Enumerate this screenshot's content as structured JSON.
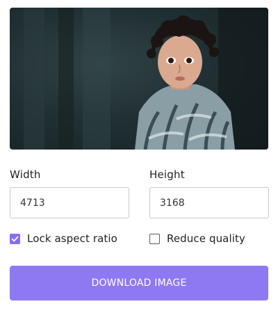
{
  "preview": {
    "image_subject": "child-portrait-photo"
  },
  "dimensions": {
    "width_label": "Width",
    "width_value": "4713",
    "height_label": "Height",
    "height_value": "3168"
  },
  "options": {
    "lock_aspect_label": "Lock aspect ratio",
    "lock_aspect_checked": true,
    "reduce_quality_label": "Reduce quality",
    "reduce_quality_checked": false
  },
  "actions": {
    "download_label": "DOWNLOAD IMAGE"
  },
  "colors": {
    "accent": "#8a6cf2",
    "button": "#8f79f2"
  }
}
